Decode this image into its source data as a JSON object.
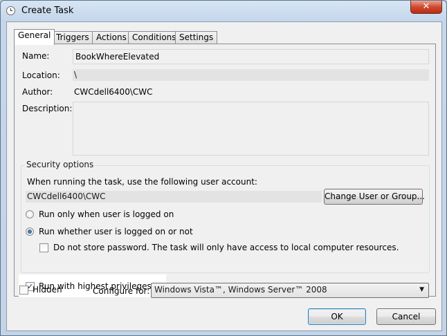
{
  "window": {
    "title": "Create Task",
    "close_glyph": "✕"
  },
  "tabs": [
    {
      "label": "General"
    },
    {
      "label": "Triggers"
    },
    {
      "label": "Actions"
    },
    {
      "label": "Conditions"
    },
    {
      "label": "Settings"
    }
  ],
  "general": {
    "name_label": "Name:",
    "name_value": "BookWhereElevated",
    "location_label": "Location:",
    "location_value": "\\",
    "author_label": "Author:",
    "author_value": "CWCdell6400\\CWC",
    "description_label": "Description:",
    "description_value": ""
  },
  "security": {
    "group_title": "Security options",
    "account_prompt": "When running the task, use the following user account:",
    "account_value": "CWCdell6400\\CWC",
    "change_user_button": "Change User or Group...",
    "radio_logged_on": "Run only when user is logged on",
    "radio_whether": "Run whether user is logged on or not",
    "no_store_password": "Do not store password.  The task will only have access to local computer resources.",
    "highest_privileges": "Run with highest privileges"
  },
  "bottom": {
    "hidden_label": "Hidden",
    "configure_label": "Configure for:",
    "configure_value": "Windows Vista™, Windows Server™ 2008",
    "ok_button": "OK",
    "cancel_button": "Cancel"
  }
}
